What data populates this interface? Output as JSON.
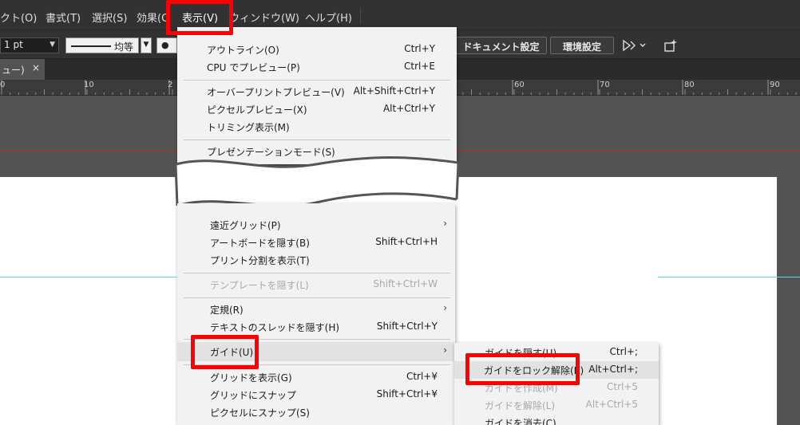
{
  "menubar": {
    "items": [
      {
        "label": "クト(O)",
        "active": false
      },
      {
        "label": "書式(T)",
        "active": false
      },
      {
        "label": "選択(S)",
        "active": false
      },
      {
        "label": "効果(C",
        "active": false
      },
      {
        "label": "表示(V)",
        "active": true
      },
      {
        "label": "ウィンドウ(W)",
        "active": false
      },
      {
        "label": "ヘルプ(H)",
        "active": false
      }
    ]
  },
  "control_bar": {
    "stroke_weight": "1 pt",
    "stroke_style_label": "均等",
    "dot_label": "●",
    "document_setup_label": "ドキュメント設定",
    "preferences_label": "環境設定"
  },
  "tab": {
    "label": "ュー)",
    "close": "×"
  },
  "ruler": {
    "numbers": [
      "0",
      "10",
      "2",
      "60",
      "70",
      "80",
      "90"
    ]
  },
  "view_menu_top": [
    {
      "label": "アウトライン(O)",
      "shortcut": "Ctrl+Y",
      "disabled": false
    },
    {
      "label": "CPU でプレビュー(P)",
      "shortcut": "Ctrl+E",
      "disabled": false
    },
    {
      "label": "オーバープリントプレビュー(V)",
      "shortcut": "Alt+Shift+Ctrl+Y",
      "disabled": false
    },
    {
      "label": "ピクセルプレビュー(X)",
      "shortcut": "Alt+Ctrl+Y",
      "disabled": false
    },
    {
      "label": "トリミング表示(M)",
      "shortcut": "",
      "disabled": false
    },
    {
      "label": "プレゼンテーションモード(S)",
      "shortcut": "",
      "disabled": false
    }
  ],
  "view_menu_bottom": [
    {
      "label": "遠近グリッド(P)",
      "shortcut": "",
      "submenu": true,
      "disabled": false
    },
    {
      "label": "アートボードを隠す(B)",
      "shortcut": "Shift+Ctrl+H",
      "submenu": false,
      "disabled": false
    },
    {
      "label": "プリント分割を表示(T)",
      "shortcut": "",
      "submenu": false,
      "disabled": false
    },
    {
      "label": "テンプレートを隠す(L)",
      "shortcut": "Shift+Ctrl+W",
      "submenu": false,
      "disabled": true
    },
    {
      "label": "定規(R)",
      "shortcut": "",
      "submenu": true,
      "disabled": false
    },
    {
      "label": "テキストのスレッドを隠す(H)",
      "shortcut": "Shift+Ctrl+Y",
      "submenu": false,
      "disabled": false
    },
    {
      "label": "ガイド(U)",
      "shortcut": "",
      "submenu": true,
      "disabled": false
    },
    {
      "label": "グリッドを表示(G)",
      "shortcut": "Ctrl+¥",
      "submenu": false,
      "disabled": false
    },
    {
      "label": "グリッドにスナップ",
      "shortcut": "Shift+Ctrl+¥",
      "submenu": false,
      "disabled": false
    },
    {
      "label": "ピクセルにスナップ(S)",
      "shortcut": "",
      "submenu": false,
      "disabled": false
    }
  ],
  "guide_submenu": [
    {
      "label": "ガイドを隠す(U)",
      "shortcut": "Ctrl+;",
      "disabled": false
    },
    {
      "label": "ガイドをロック解除(K)",
      "shortcut": "Alt+Ctrl+;",
      "disabled": false
    },
    {
      "label": "ガイドを作成(M)",
      "shortcut": "Ctrl+5",
      "disabled": true
    },
    {
      "label": "ガイドを解除(L)",
      "shortcut": "Alt+Ctrl+5",
      "disabled": true
    },
    {
      "label": "ガイドを消去(C)",
      "shortcut": "",
      "disabled": false
    }
  ],
  "colors": {
    "callout": "#ff0000",
    "guide": "#59d9e0",
    "bleed": "#b43030",
    "menu_bg": "#f2f2f2",
    "app_bg": "#535353"
  },
  "submenu_arrow": "›"
}
